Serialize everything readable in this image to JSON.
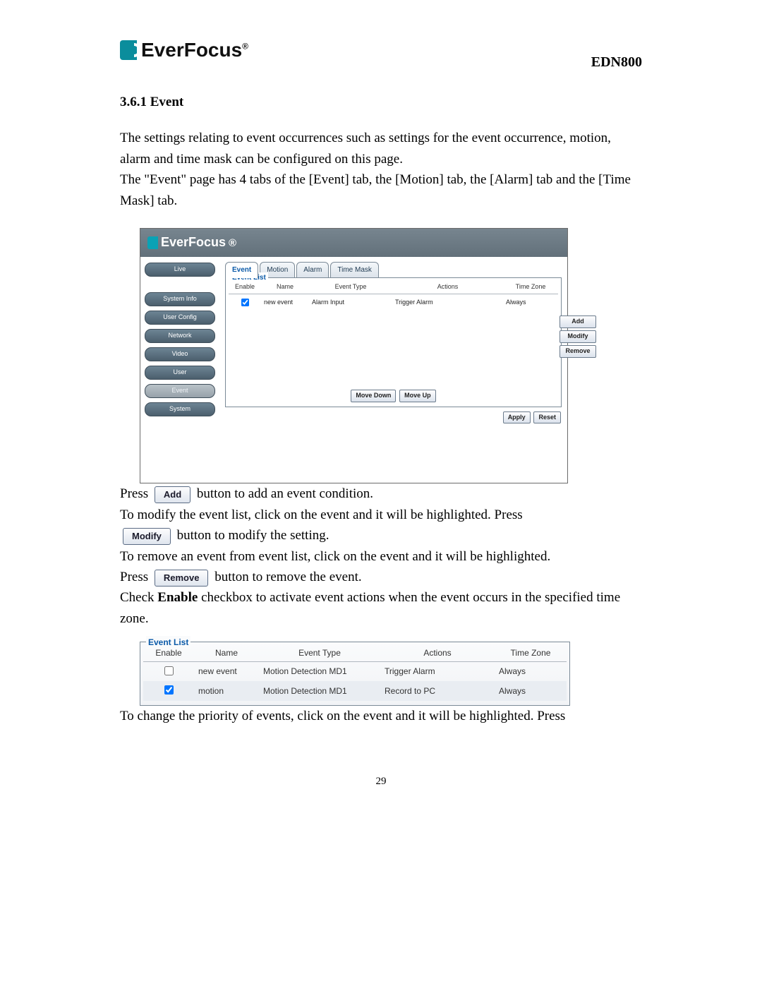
{
  "header": {
    "brand": "EverFocus",
    "reg": "®",
    "model": "EDN800"
  },
  "section": {
    "number_title": "3.6.1 Event",
    "para1": "The settings relating to event occurrences such as settings for the event occurrence, motion, alarm and time mask can be configured on this page.",
    "para2": "The \"Event\" page has 4 tabs of the [Event] tab, the [Motion] tab, the [Alarm] tab and the [Time Mask] tab."
  },
  "screenshot": {
    "brand": "EverFocus",
    "reg": "®",
    "sidebar": {
      "live": "Live",
      "system_info": "System Info",
      "user_config": "User Config",
      "network": "Network",
      "video": "Video",
      "user": "User",
      "event": "Event",
      "system": "System"
    },
    "tabs": {
      "event": "Event",
      "motion": "Motion",
      "alarm": "Alarm",
      "time_mask": "Time Mask"
    },
    "event_list": {
      "legend": "Event List",
      "headers": {
        "enable": "Enable",
        "name": "Name",
        "event_type": "Event Type",
        "actions": "Actions",
        "time_zone": "Time Zone"
      },
      "rows": [
        {
          "enable": true,
          "name": "new event",
          "event_type": "Alarm Input",
          "actions": "Trigger Alarm",
          "time_zone": "Always"
        }
      ],
      "move_down": "Move Down",
      "move_up": "Move Up"
    },
    "side_buttons": {
      "add": "Add",
      "modify": "Modify",
      "remove": "Remove"
    },
    "footer_buttons": {
      "apply": "Apply",
      "reset": "Reset"
    }
  },
  "instructions": {
    "press1": "Press",
    "add_btn": "Add",
    "after_add": "button to add an event condition.",
    "modify_line": "To modify the event list, click on the event and it will be highlighted. Press",
    "modify_btn": "Modify",
    "after_modify": "button to modify the setting.",
    "remove_line": "To remove an event from event list, click on the event and it will be highlighted.",
    "press2": "Press",
    "remove_btn": "Remove",
    "after_remove": "button to remove the event.",
    "enable_para_a": "Check ",
    "enable_bold": "Enable",
    "enable_para_b": " checkbox to activate event actions when the event occurs in the specified time zone."
  },
  "event_list2": {
    "legend": "Event List",
    "headers": {
      "enable": "Enable",
      "name": "Name",
      "event_type": "Event Type",
      "actions": "Actions",
      "time_zone": "Time Zone"
    },
    "rows": [
      {
        "enable": false,
        "name": "new event",
        "event_type": "Motion Detection MD1",
        "actions": "Trigger Alarm",
        "time_zone": "Always",
        "selected": false
      },
      {
        "enable": true,
        "name": "motion",
        "event_type": "Motion Detection MD1",
        "actions": "Record to PC",
        "time_zone": "Always",
        "selected": true
      }
    ]
  },
  "priority_para": "To change the priority of events, click on the event and it will be highlighted. Press",
  "page_number": "29"
}
